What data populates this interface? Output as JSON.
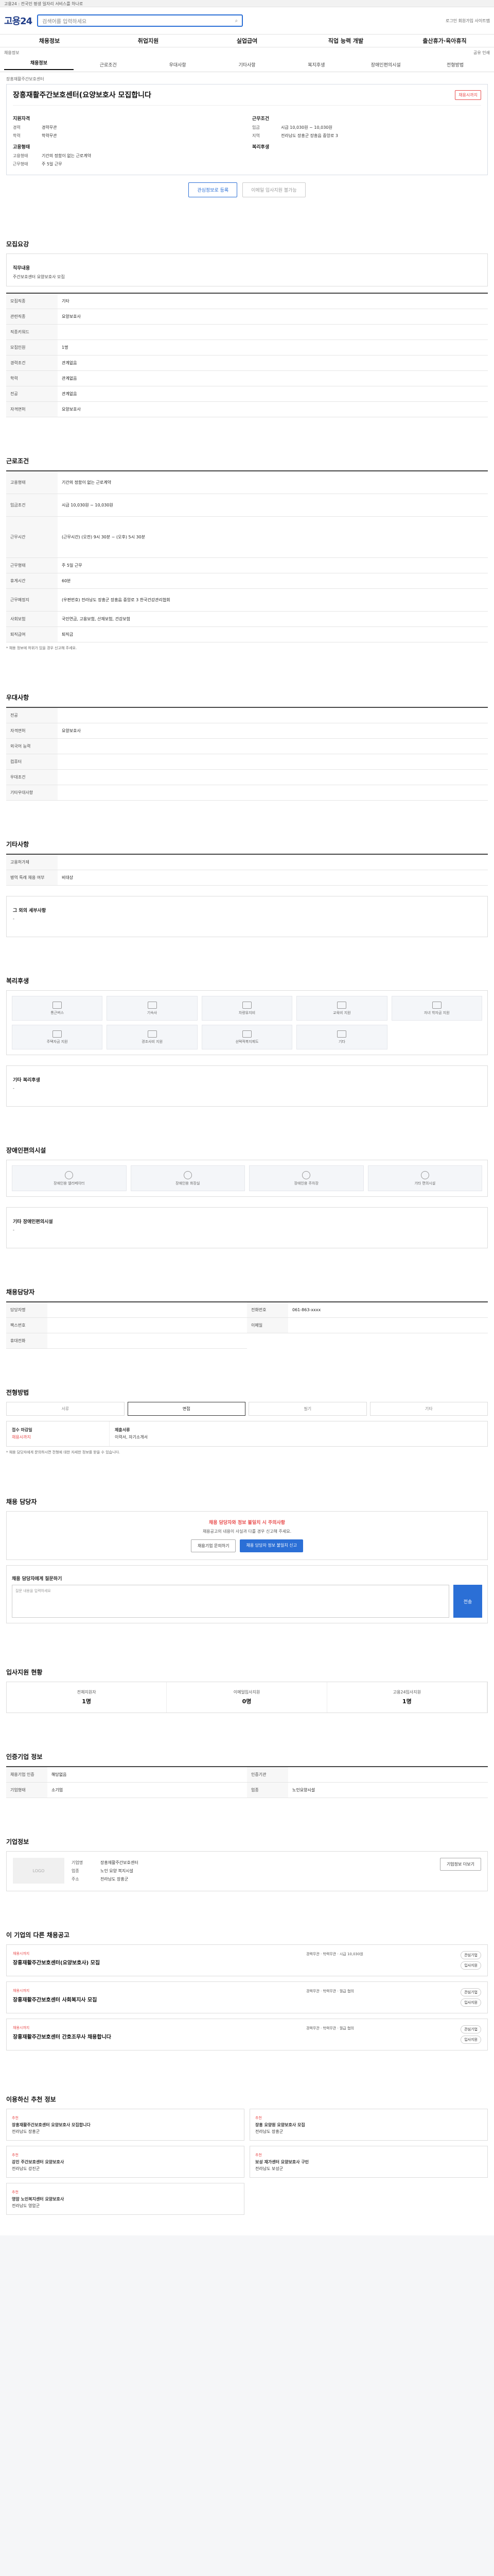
{
  "topbar": "고용24 : 전국민 평생 일자리 서비스를 하나로",
  "header": {
    "logo": "고용24",
    "search_placeholder": "검색어를 입력하세요",
    "right": "로그인 회원가입 사이트맵"
  },
  "gnb": [
    "채용정보",
    "취업지원",
    "실업급여",
    "직업 능력 개발",
    "출산휴가·육아휴직"
  ],
  "subbar": {
    "left": "채용정보",
    "right": "공유 인쇄"
  },
  "tabs": [
    "채용정보",
    "근로조건",
    "우대사항",
    "기타사항",
    "복지후생",
    "장애인편의시설",
    "전형방법"
  ],
  "job": {
    "company": "장흥재활주간보호센터",
    "title": "장흥재활주간보호센터(요양보호사 모집합니다",
    "badge": "채용시까지",
    "left_h": "지원자격",
    "left": [
      [
        "경력",
        "경력무관"
      ],
      [
        "학력",
        "학력무관"
      ]
    ],
    "left_h2": "고용형태",
    "left2": [
      [
        "고용형태",
        "기간의 정함이 없는 근로계약"
      ],
      [
        "근무형태",
        "주 5일 근무"
      ]
    ],
    "right_h": "근무조건",
    "right": [
      [
        "임금",
        "시급 10,030원 ~ 10,030원"
      ],
      [
        "지역",
        "전라남도 장흥군 장흥읍 중앙로 3"
      ]
    ],
    "right_h2": "복리후생"
  },
  "buttons": {
    "save": "관심정보로 등록",
    "apply": "이메일 입사지원 불가능"
  },
  "sec_qual": {
    "title": "모집요강",
    "h": "직무내용",
    "text": "주간보호센터 요양보호사 모집",
    "rows": [
      [
        "모집직종",
        "기타"
      ],
      [
        "관련직종",
        "요양보호사"
      ],
      [
        "직종키워드",
        ""
      ],
      [
        "모집인원",
        "1명"
      ],
      [
        "경력조건",
        "관계없음"
      ],
      [
        "학력",
        "관계없음"
      ],
      [
        "전공",
        "관계없음"
      ],
      [
        "자격면허",
        "요양보호사"
      ]
    ]
  },
  "sec_cond": {
    "title": "근로조건",
    "rows": [
      [
        "고용형태",
        "기간의 정함이 없는 근로계약"
      ],
      [
        "임금조건",
        "시급 10,030원 ~ 10,030원"
      ],
      [
        "근무시간",
        "(근무시간) (오전) 9시 30분 ~ (오후) 5시 30분"
      ],
      [
        "근무형태",
        "주 5일 근무"
      ],
      [
        "휴게시간",
        "60분"
      ],
      [
        "근무예정지",
        "(우편번호) 전라남도 장흥군 장흥읍 중앙로 3 한국건강관리협회"
      ],
      [
        "사회보험",
        "국민연금, 고용보험, 산재보험, 건강보험"
      ],
      [
        "퇴직급여",
        "퇴직금"
      ]
    ],
    "note": "* 채용 정보에 허위가 있을 경우 신고해 주세요."
  },
  "sec_pref": {
    "title": "우대사항",
    "rows": [
      [
        "전공",
        ""
      ],
      [
        "자격면허",
        "요양보호사"
      ],
      [
        "외국어 능력",
        ""
      ],
      [
        "컴퓨터",
        ""
      ],
      [
        "우대조건",
        ""
      ],
      [
        "기타우대사항",
        ""
      ]
    ]
  },
  "sec_etc": {
    "title": "기타사항",
    "rows": [
      [
        "고용허가제",
        ""
      ],
      [
        "병역 특례 채용 여부",
        "비대상"
      ]
    ],
    "memo_h": "그 외의 세부사항",
    "memo": "-"
  },
  "sec_welf": {
    "title": "복리후생",
    "items": [
      "통근버스",
      "기숙사",
      "차량유지비",
      "교육비 지원",
      "자녀 학자금 지원",
      "주택자금 지원",
      "경조사비 지원",
      "선택적복지제도",
      "기타"
    ],
    "etc_h": "기타 복리후생",
    "etc": "-"
  },
  "sec_dis": {
    "title": "장애인편의시설",
    "items": [
      "장애인용 엘리베이터",
      "장애인용 화장실",
      "장애인용 주차장",
      "기타 편의시설"
    ],
    "etc": "기타 장애인편의시설",
    "etc_v": "-"
  },
  "sec_pers": {
    "title": "채용담당자",
    "rows": [
      [
        "담당자명",
        ""
      ],
      [
        "전화번호",
        "061-863-xxxx"
      ],
      [
        "팩스번호",
        ""
      ],
      [
        "이메일",
        ""
      ],
      [
        "휴대전화",
        ""
      ]
    ]
  },
  "sec_sel": {
    "title": "전형방법",
    "methods": [
      "서류",
      "면접",
      "필기",
      "기타"
    ],
    "period_h": "접수 마감일",
    "period": "채용시까지",
    "docs_h": "제출서류",
    "docs": "이력서, 자기소개서",
    "note": "* 채용 담당자에게 문의하시면 전형에 대한 자세한 정보를 받을 수 있습니다."
  },
  "sec_ask": {
    "title": "채용 담당자",
    "warn": "채용 담당자와 정보 불일치 시 주의사항",
    "text": "채용공고의 내용이 사실과 다를 경우 신고해 주세요.",
    "b1": "채용기업 문의하기",
    "b2": "채용 담당자 정보 불일치 신고",
    "q_h": "채용 담당자에게 질문하기",
    "q_ph": "질문 내용을 입력하세요",
    "q_btn": "전송"
  },
  "sec_stat": {
    "title": "입사지원 현황",
    "items": [
      [
        "전체지원자",
        "1명"
      ],
      [
        "이메일입사지원",
        "0명"
      ],
      [
        "고용24입사지원",
        "1명"
      ]
    ]
  },
  "sec_info": {
    "title": "인증기업 정보",
    "rows": [
      [
        "채용기업 인증",
        "해당없음"
      ],
      [
        "인증기관",
        ""
      ],
      [
        "기업형태",
        "소기업"
      ],
      [
        "업종",
        "노인요양시설"
      ]
    ]
  },
  "sec_comp": {
    "title": "기업정보",
    "logo": "LOGO",
    "rows": [
      [
        "기업명",
        "장흥재활주간보호센터"
      ],
      [
        "업종",
        "노인 요양 복지시설"
      ],
      [
        "주소",
        "전라남도 장흥군"
      ]
    ],
    "btn": "기업정보 더보기"
  },
  "sec_jobs": {
    "title": "이 기업의 다른 채용공고",
    "items": [
      {
        "tag": "채용시까지",
        "name": "장흥재활주간보호센터(요양보호사) 모집",
        "meta": "경력무관 · 학력무관 · 시급 10,030원"
      },
      {
        "tag": "채용시까지",
        "name": "장흥재활주간보호센터 사회복지사 모집",
        "meta": "경력무관 · 학력무관 · 월급 협의"
      },
      {
        "tag": "채용시까지",
        "name": "장흥재활주간보호센터 간호조무사 채용합니다",
        "meta": "경력무관 · 학력무관 · 월급 협의"
      }
    ],
    "btns": [
      "관심기업",
      "입사지원"
    ]
  },
  "sec_rec": {
    "title": "이용하신 추천 정보",
    "items": [
      {
        "tag": "추천",
        "name": "장흥재활주간보호센터 요양보호사 모집합니다",
        "meta": "전라남도 장흥군"
      },
      {
        "tag": "추천",
        "name": "장흥 요양원 요양보호사 모집",
        "meta": "전라남도 장흥군"
      },
      {
        "tag": "추천",
        "name": "강진 주간보호센터 요양보호사",
        "meta": "전라남도 강진군"
      },
      {
        "tag": "추천",
        "name": "보성 재가센터 요양보호사 구인",
        "meta": "전라남도 보성군"
      },
      {
        "tag": "추천",
        "name": "영암 노인복지센터 요양보호사",
        "meta": "전라남도 영암군"
      }
    ]
  }
}
